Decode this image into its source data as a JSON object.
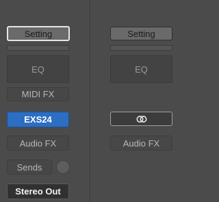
{
  "left_strip": {
    "setting_label": "Setting",
    "eq_label": "EQ",
    "midi_fx_label": "MIDI FX",
    "instrument_label": "EXS24",
    "audio_fx_label": "Audio FX",
    "sends_label": "Sends",
    "output_label": "Stereo Out"
  },
  "right_strip": {
    "setting_label": "Setting",
    "eq_label": "EQ",
    "input_icon": "link-rings-icon",
    "audio_fx_label": "Audio FX"
  },
  "colors": {
    "background": "#4b4b4b",
    "instrument_slot": "#2c6ec2"
  }
}
